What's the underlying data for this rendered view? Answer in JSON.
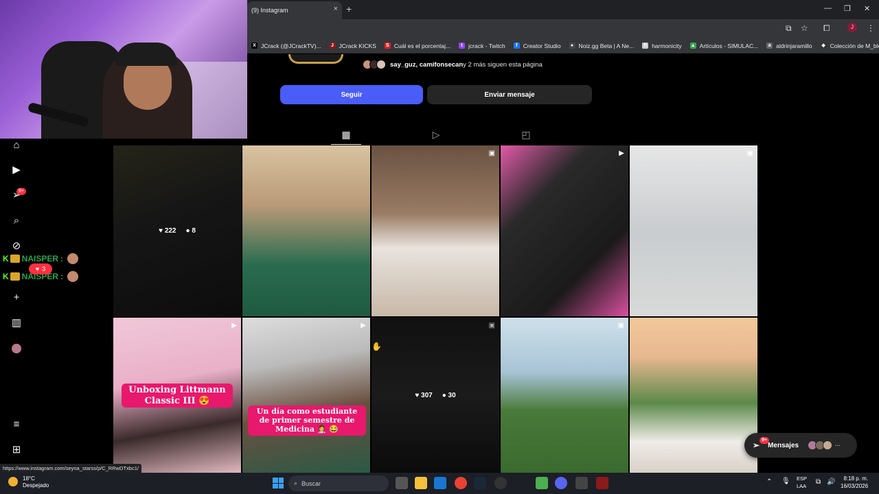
{
  "browser": {
    "tab_title": "(9) Instagram",
    "tab_close": "×",
    "new_tab": "+",
    "bookmarks": [
      {
        "label": "JCrack (@JCrackTV)...",
        "color": "#000000",
        "glyph": "X"
      },
      {
        "label": "JCrack KICKS",
        "color": "#8b1a1a",
        "glyph": "J"
      },
      {
        "label": "Cuál es el porcentaj...",
        "color": "#d22",
        "glyph": "S"
      },
      {
        "label": "jcrack - Twitch",
        "color": "#9146ff",
        "glyph": "t"
      },
      {
        "label": "Creator Studio",
        "color": "#1877f2",
        "glyph": "f"
      },
      {
        "label": "Noiz.gg Beta | A Ne...",
        "color": "#444444",
        "glyph": "●"
      },
      {
        "label": "harmonicity",
        "color": "#cccccc",
        "glyph": "h"
      },
      {
        "label": "Artículos - SIMULAC...",
        "color": "#34a853",
        "glyph": "▲"
      },
      {
        "label": "aldrinjaramillo",
        "color": "#666666",
        "glyph": "a"
      },
      {
        "label": "Colección de M_blei...",
        "color": "#333333",
        "glyph": "◆"
      }
    ],
    "more_bookmarks": "»"
  },
  "profile": {
    "follower_avatars": [
      "#c9927a",
      "#3b2b2b",
      "#d8c4b6"
    ],
    "followed_by_names": "say_guz, camifonsecan",
    "followed_by_rest": " y 2 más siguen esta página",
    "follow_button": "Seguir",
    "message_button": "Enviar mensaje"
  },
  "sidebar": {
    "notifications_badge": "9+",
    "items": [
      "home-icon",
      "reels-icon",
      "messages-icon",
      "search-icon",
      "explore-icon",
      "create-icon",
      "insights-icon",
      "profile-icon",
      "menu-icon",
      "apps-icon"
    ]
  },
  "grid": [
    {
      "likes": "222",
      "comments": "8",
      "bg": "linear-gradient(160deg,#3a3826 0%,#222 40%,#141414 100%)",
      "type": "",
      "hover": true
    },
    {
      "bg": "linear-gradient(180deg,#d9c3a0 0%,#b99a78 35%,#2a6b4f 70%,#1e5a3f 100%)",
      "type": ""
    },
    {
      "bg": "linear-gradient(180deg,#6a5242 0%,#9a7c64 40%,#e8e3de 60%,#c8b8a8 100%)",
      "type": "▣"
    },
    {
      "bg": "linear-gradient(135deg,#e25aa8 0%,#2a2a2a 30%,#1a1a1a 70%,#d94f9e 100%)",
      "type": "▶"
    },
    {
      "bg": "linear-gradient(180deg,#e6e6e6 0%,#c9cccf 50%,#d8dad9 100%)",
      "type": "▣"
    },
    {
      "bg": "linear-gradient(170deg,#f0c8d8 0%,#e9b0c8 40%,#3a2a2a 70%,#e0b8c0 100%)",
      "type": "▶",
      "caption": "Unboxing Littmann Classic III 😍"
    },
    {
      "bg": "linear-gradient(170deg,#ddd 0%,#bbb 30%,#6a5040 60%,#2a5a45 100%)",
      "type": "▶",
      "caption": "Un día como estudiante de primer semestre de Medicina 👩‍⚕️ 😂"
    },
    {
      "likes": "307",
      "comments": "30",
      "bg": "linear-gradient(180deg,#1a1a1a 0%,#2a2a2a 50%,#111 100%)",
      "type": "▣",
      "hover": true
    },
    {
      "bg": "linear-gradient(180deg,#cfe0ea 0%,#a8c4d6 35%,#4a7a3a 60%,#3a6a2e 100%)",
      "type": "▣"
    },
    {
      "bg": "linear-gradient(180deg,#f2c89a 0%,#e8b890 25%,#5c8a4a 55%,#f0ece8 80%,#d8d0c8 100%)",
      "type": ""
    }
  ],
  "chat": [
    {
      "user": "NAISPER",
      "sep": ":"
    },
    {
      "user": "NAISPER",
      "sep": ":"
    }
  ],
  "heart_count": "3",
  "messages_pill": {
    "label": "Mensajes",
    "badge": "9+",
    "avatars": [
      "#b07aa0",
      "#7a6a5a",
      "#c8a890"
    ],
    "more": "···"
  },
  "status_url": "https://www.instagram.com/seyna_starss/p/C_RRwDTxbc1/",
  "taskbar": {
    "weather_temp": "18°C",
    "weather_desc": "Despejado",
    "search_placeholder": "Buscar",
    "lang_1": "ESP",
    "lang_2": "LAA",
    "time": "8:18 p. m.",
    "date": "16/03/2026"
  }
}
